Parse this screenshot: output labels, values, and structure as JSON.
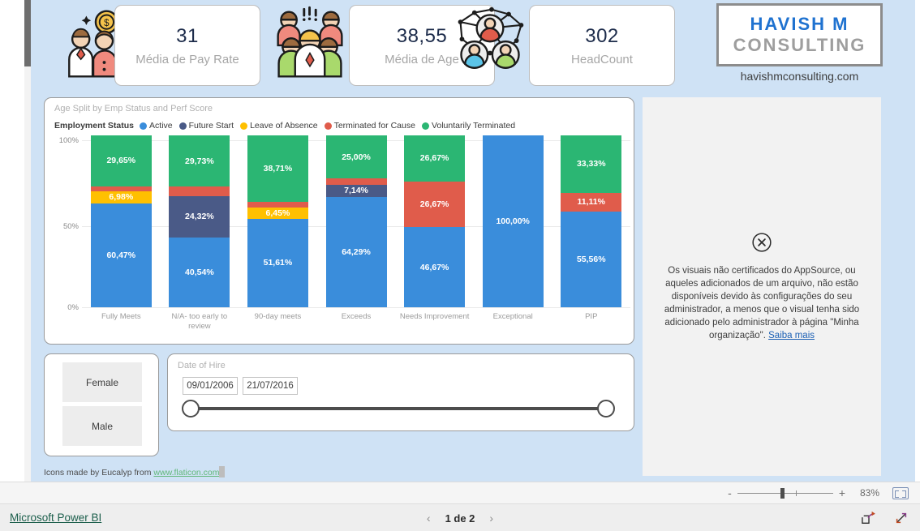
{
  "kpis": [
    {
      "icon": "people-money-icon",
      "value": "31",
      "label": "Média de Pay Rate"
    },
    {
      "icon": "people-group-icon",
      "value": "38,55",
      "label": "Média de Age"
    },
    {
      "icon": "people-network-icon",
      "value": "302",
      "label": "HeadCount"
    }
  ],
  "logo": {
    "line1": "HAVISH M",
    "line2": "CONSULTING",
    "url": "havishmconsulting.com"
  },
  "chart_data": {
    "type": "bar",
    "title": "Age Split by Emp Status and Perf Score",
    "legend_title": "Employment Status",
    "legend_position": "top",
    "stacked": true,
    "normalized": true,
    "xlabel": "",
    "ylabel": "",
    "ylim": [
      0,
      100
    ],
    "yticks": [
      "0%",
      "50%",
      "100%"
    ],
    "grid": true,
    "categories": [
      "Fully Meets",
      "N/A- too early to review",
      "90-day meets",
      "Exceeds",
      "Needs Improvement",
      "Exceptional",
      "PIP"
    ],
    "series": [
      {
        "name": "Active",
        "color": "#3a8ddb",
        "values": [
          60.47,
          40.54,
          51.61,
          64.29,
          46.67,
          100.0,
          55.56
        ],
        "labels": [
          "60,47%",
          "40,54%",
          "51,61%",
          "64,29%",
          "46,67%",
          "100,00%",
          "55,56%"
        ]
      },
      {
        "name": "Future Start",
        "color": "#4a5a87",
        "values": [
          0,
          24.32,
          0,
          7.14,
          0,
          0,
          0
        ],
        "labels": [
          "",
          "24,32%",
          "",
          "7,14%",
          "",
          "",
          ""
        ]
      },
      {
        "name": "Leave of Absence",
        "color": "#ffc000",
        "values": [
          6.98,
          0,
          6.45,
          0,
          0,
          0,
          0
        ],
        "labels": [
          "6,98%",
          "",
          "6,45%",
          "",
          "",
          "",
          ""
        ]
      },
      {
        "name": "Terminated for Cause",
        "color": "#e05c4b",
        "values": [
          2.9,
          5.41,
          3.23,
          3.57,
          26.67,
          0,
          11.11
        ],
        "labels": [
          "",
          "",
          "",
          "",
          "26,67%",
          "",
          "11,11%"
        ]
      },
      {
        "name": "Voluntarily Terminated",
        "color": "#2bb673",
        "values": [
          29.65,
          29.73,
          38.71,
          25.0,
          26.67,
          0,
          33.33
        ],
        "labels": [
          "29,65%",
          "29,73%",
          "38,71%",
          "25,00%",
          "26,67%",
          "",
          "33,33%"
        ]
      }
    ]
  },
  "gender_slicer": {
    "options": [
      "Female",
      "Male"
    ]
  },
  "date_slicer": {
    "title": "Date of Hire",
    "from": "09/01/2006",
    "to": "21/07/2016"
  },
  "credit": {
    "text_before": "Icons made by Eucalyp from ",
    "link": "www.flaticon.com"
  },
  "blocked_visual": {
    "icon": "error-circle-x-icon",
    "message": "Os visuais não certificados do AppSource, ou aqueles adicionados de um arquivo, não estão disponíveis devido às configurações do seu administrador, a menos que o visual tenha sido adicionado pelo administrador à página \"Minha organização\". ",
    "link": "Saiba mais"
  },
  "statusbar": {
    "zoom_minus": "-",
    "zoom_plus": "+",
    "zoom_level": "83%",
    "fit_icon": "fit-to-page-icon"
  },
  "footer": {
    "brand": "Microsoft Power BI",
    "prev": "‹",
    "next": "›",
    "page_text": "1 de 2",
    "share_icon": "share-icon",
    "fullscreen_icon": "fullscreen-icon"
  }
}
